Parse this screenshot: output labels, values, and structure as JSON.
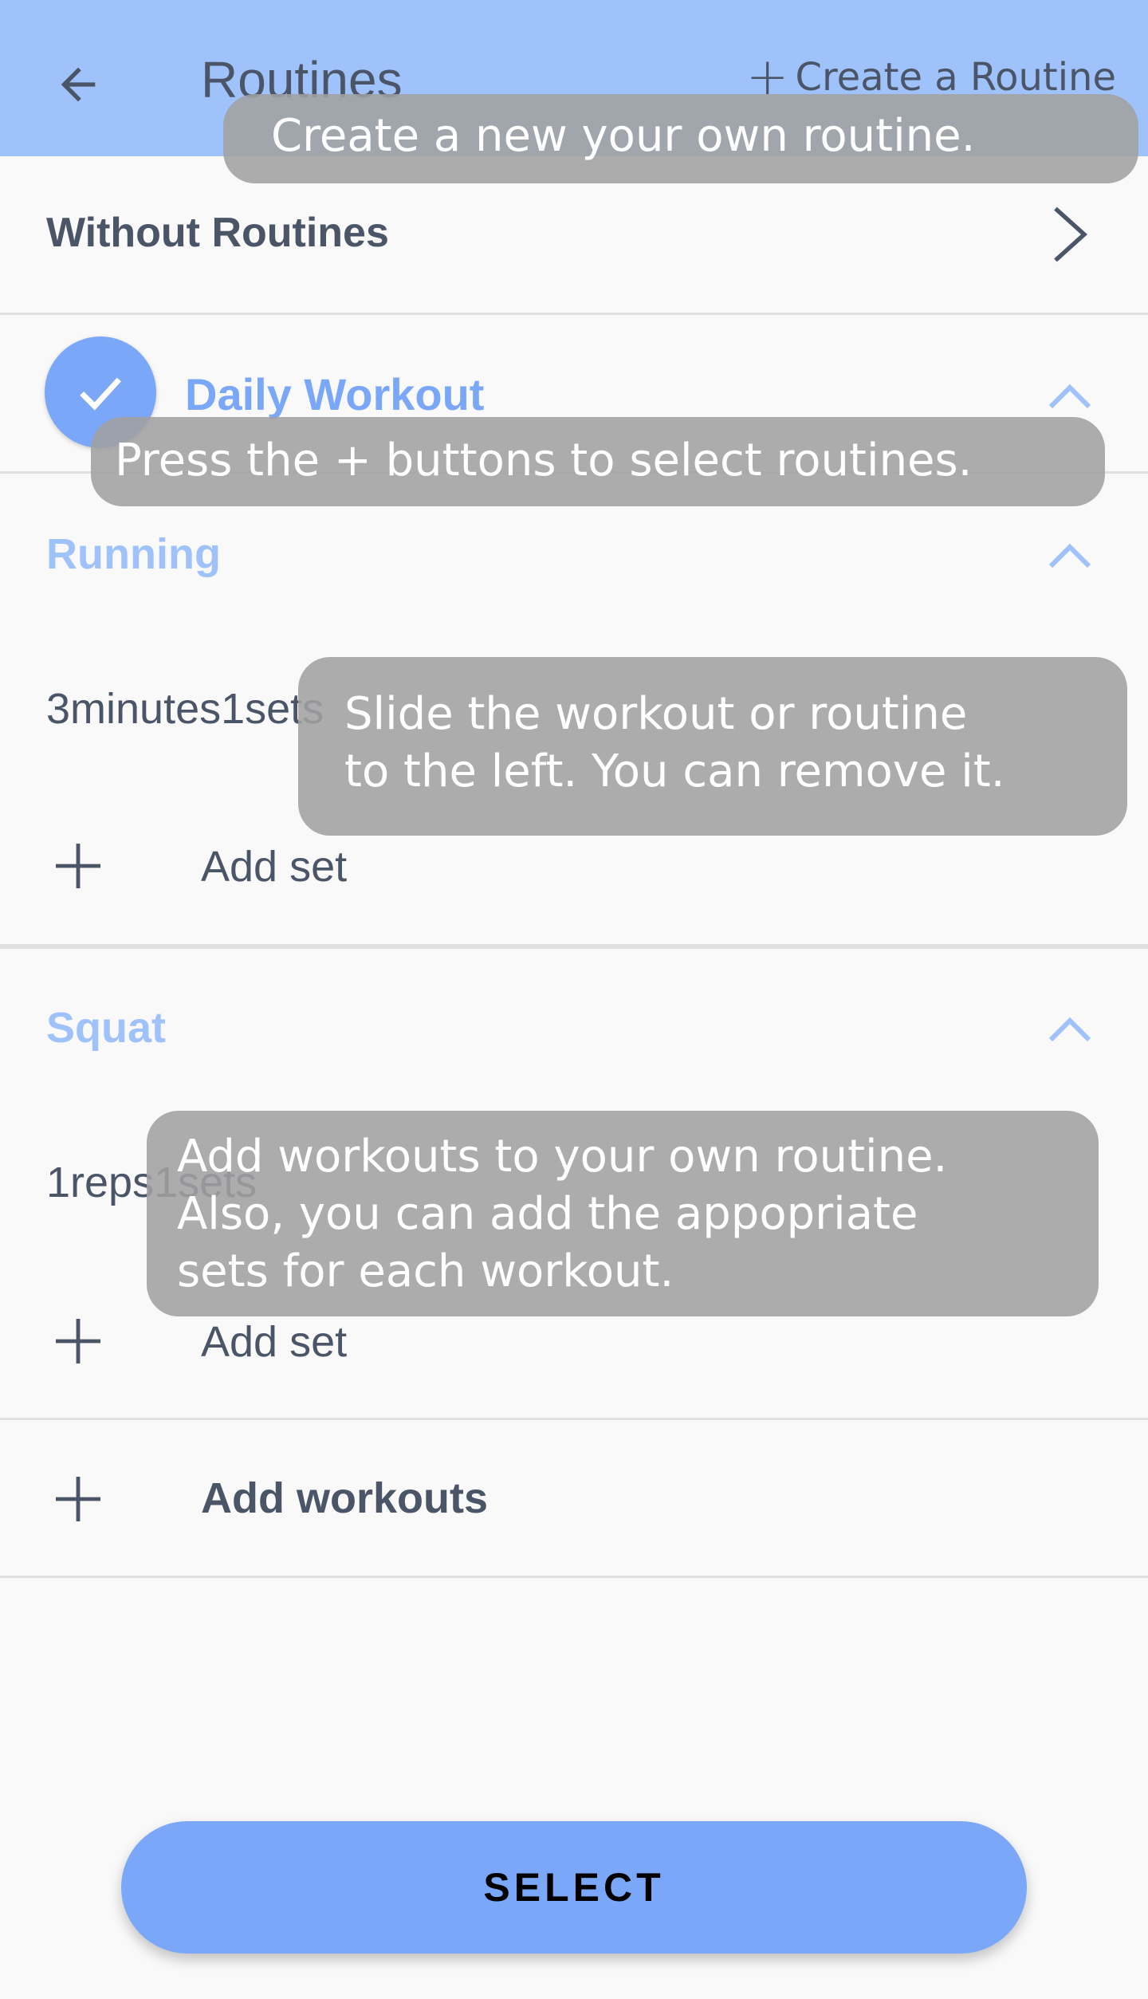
{
  "appbar": {
    "title": "Routines",
    "create_label": "Create a Routine",
    "back_icon": "arrow-left-icon",
    "create_icon": "plus-icon",
    "background_color": "#a0c2fa"
  },
  "routines": {
    "without_routines_label": "Without Routines",
    "selected_routine": {
      "name": "Daily Workout",
      "selected": true,
      "accent_color": "#7aa7f7"
    },
    "workouts": [
      {
        "name": "Running",
        "sets": [
          "3minutes1sets"
        ],
        "add_set_label": "Add set"
      },
      {
        "name": "Squat",
        "sets": [
          "1reps1sets"
        ],
        "add_set_label": "Add set"
      }
    ],
    "add_workouts_label": "Add workouts"
  },
  "tooltips": {
    "create": "Create a new your own routine.",
    "select": "Press the + buttons to select routines.",
    "slide_line1": "Slide the workout or routine",
    "slide_line2": "to the left. You can remove it.",
    "add_line1": "Add workouts to your own routine.",
    "add_line2": "Also, you can add the appopriate",
    "add_line3": "sets for each workout."
  },
  "select_button": {
    "label": "SELECT",
    "color": "#7aa7f7"
  }
}
